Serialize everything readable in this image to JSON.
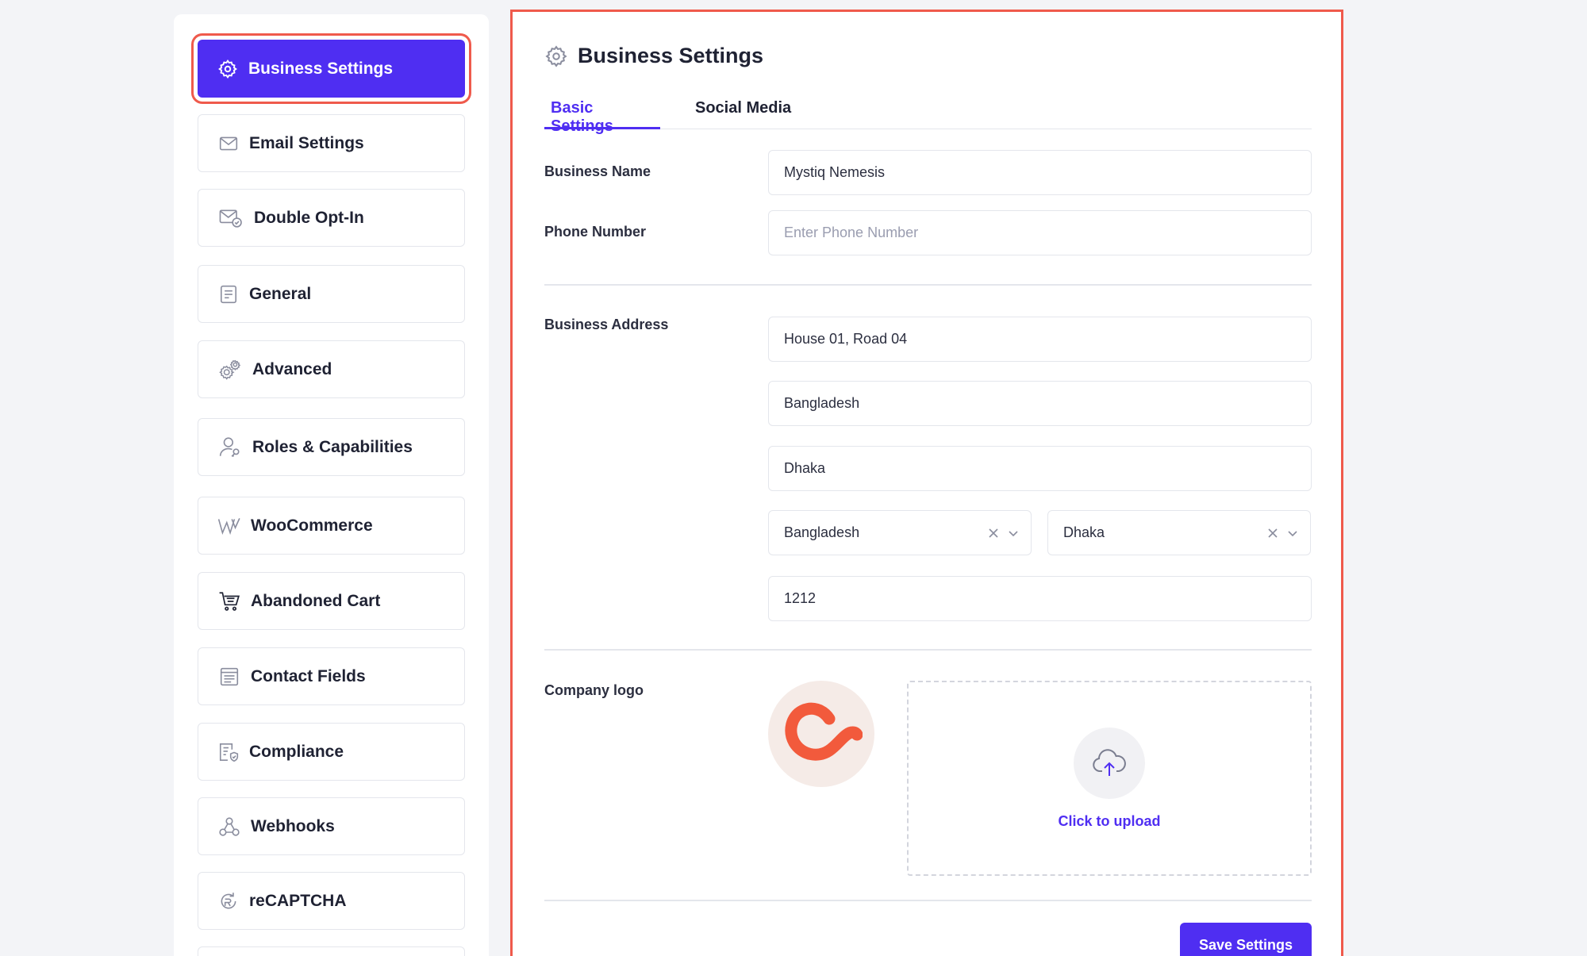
{
  "sidebar": {
    "items": [
      {
        "label": "Business Settings",
        "icon": "gear-icon",
        "active": true
      },
      {
        "label": "Email Settings",
        "icon": "envelope-icon"
      },
      {
        "label": "Double Opt-In",
        "icon": "envelope-check-icon"
      },
      {
        "label": "General",
        "icon": "document-icon"
      },
      {
        "label": "Advanced",
        "icon": "gears-icon"
      },
      {
        "label": "Roles & Capabilities",
        "icon": "user-key-icon"
      },
      {
        "label": "WooCommerce",
        "icon": "woocommerce-icon"
      },
      {
        "label": "Abandoned Cart",
        "icon": "cart-icon"
      },
      {
        "label": "Contact Fields",
        "icon": "list-form-icon"
      },
      {
        "label": "Compliance",
        "icon": "shield-document-icon"
      },
      {
        "label": "Webhooks",
        "icon": "webhook-icon"
      },
      {
        "label": "reCAPTCHA",
        "icon": "recaptcha-icon"
      }
    ]
  },
  "header": {
    "title": "Business Settings",
    "icon": "gear-icon"
  },
  "tabs": [
    {
      "label": "Basic Settings",
      "active": true
    },
    {
      "label": "Social Media",
      "active": false
    }
  ],
  "form": {
    "business_name_label": "Business Name",
    "business_name_value": "Mystiq Nemesis",
    "phone_label": "Phone Number",
    "phone_placeholder": "Enter Phone Number",
    "address_label": "Business Address",
    "address_line": "House 01, Road 04",
    "address_line2": "Bangladesh",
    "city": "Dhaka",
    "country_select": "Bangladesh",
    "state_select": "Dhaka",
    "postal_code": "1212",
    "logo_label": "Company logo",
    "upload_text": "Click to upload",
    "save_label": "Save Settings"
  },
  "colors": {
    "accent": "#4f2ef2",
    "highlight_border": "#ef5a4c",
    "logo": "#f25a3c"
  }
}
